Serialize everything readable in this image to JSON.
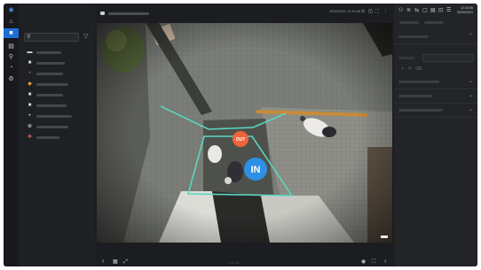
{
  "rail": {
    "items": [
      {
        "icon": "logo-icon",
        "glyph": "◉"
      },
      {
        "icon": "home-icon",
        "glyph": "⌂"
      },
      {
        "icon": "camera-icon",
        "glyph": "■",
        "active": true
      },
      {
        "icon": "grid-icon",
        "glyph": "▤"
      },
      {
        "icon": "search-icon",
        "glyph": "⚲"
      },
      {
        "icon": "alarm-icon",
        "glyph": "◔"
      },
      {
        "icon": "settings-icon",
        "glyph": "⚙"
      }
    ]
  },
  "tree": {
    "search": {
      "placeholder": "",
      "value": ""
    },
    "items": [
      {
        "icon": "device-icon",
        "glyph": "▬",
        "color": "#d9dbde"
      },
      {
        "icon": "camera-icon",
        "glyph": "■",
        "color": "#d9dbde"
      },
      {
        "icon": "add-icon",
        "glyph": "+",
        "color": "#e25a4a"
      },
      {
        "icon": "ptz-camera-icon",
        "glyph": "◆",
        "color": "#e89a3c"
      },
      {
        "icon": "camera-icon",
        "glyph": "■",
        "color": "#d9dbde"
      },
      {
        "icon": "camera-icon",
        "glyph": "■",
        "color": "#d9dbde"
      },
      {
        "icon": "add-icon",
        "glyph": "+",
        "color": "#d9dbde"
      },
      {
        "icon": "link-icon",
        "glyph": "⊕",
        "color": "#d9dbde"
      },
      {
        "icon": "alert-icon",
        "glyph": "✚",
        "color": "#e25a4a"
      }
    ]
  },
  "topbar": {
    "timestamp": "2024/03/21  12:34:56",
    "icons": [
      "record-icon",
      "snapshot-icon",
      "fullscreen-icon",
      "more-icon"
    ]
  },
  "viewer": {
    "out_label": "OUT",
    "in_label": "IN",
    "line_color": "#5ad6c1",
    "out_color": "#f0643a",
    "in_color": "#2f8ee6"
  },
  "bottombar": {
    "page_indicator": "‹  1 / 1  ›"
  },
  "rpanel": {
    "time": [
      "12:34:56",
      "2024/03/21"
    ],
    "icons": [
      "user-icon",
      "wifi-icon",
      "share-icon",
      "window-icon",
      "layout-icon",
      "lock-icon",
      "menu-icon"
    ]
  }
}
